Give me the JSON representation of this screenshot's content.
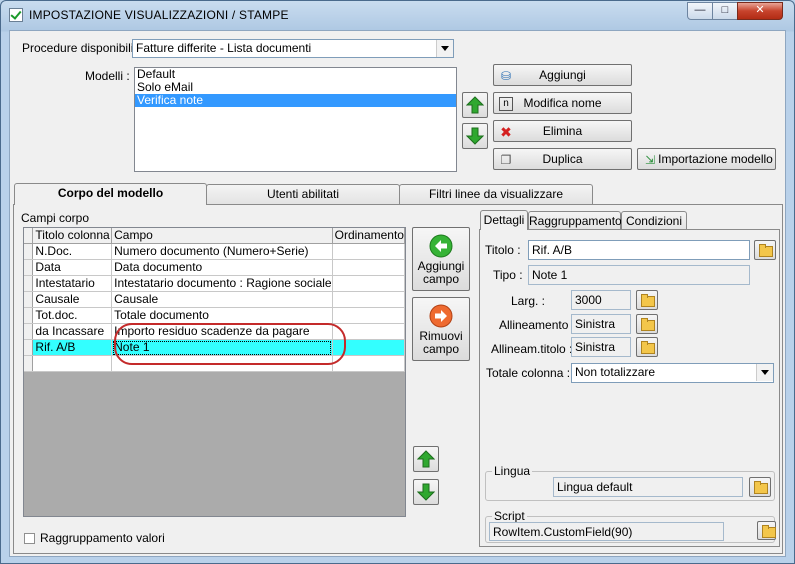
{
  "window": {
    "title": "IMPOSTAZIONE VISUALIZZAZIONI / STAMPE",
    "controls": {
      "minimize": "—",
      "maximize": "□",
      "close": "✕"
    }
  },
  "top": {
    "procedure_label": "Procedure disponibili :",
    "procedure_value": "Fatture differite - Lista documenti",
    "models_label": "Modelli :",
    "models": [
      "Default",
      "Solo eMail",
      "Verifica note"
    ],
    "selected_model_index": 2,
    "buttons": {
      "add": "Aggiungi",
      "rename": "Modifica nome",
      "delete": "Elimina",
      "duplicate": "Duplica",
      "import": "Importazione modello"
    }
  },
  "tabs": [
    "Corpo del modello",
    "Utenti abilitati",
    "Filtri linee da visualizzare"
  ],
  "body": {
    "group_label": "Campi corpo",
    "columns": [
      "Titolo colonna",
      "Campo",
      "Ordinamento"
    ],
    "rows": [
      {
        "title": "N.Doc.",
        "field": "Numero documento (Numero+Serie)",
        "order": ""
      },
      {
        "title": "Data",
        "field": "Data documento",
        "order": ""
      },
      {
        "title": "Intestatario",
        "field": "Intestatario documento : Ragione sociale",
        "order": ""
      },
      {
        "title": "Causale",
        "field": "Causale",
        "order": ""
      },
      {
        "title": "Tot.doc.",
        "field": "Totale documento",
        "order": ""
      },
      {
        "title": "da Incassare",
        "field": "Importo residuo scadenze da pagare",
        "order": ""
      },
      {
        "title": "Rif. A/B",
        "field": "Note 1",
        "order": ""
      },
      {
        "title": "",
        "field": "",
        "order": ""
      }
    ],
    "selected_row_index": 6,
    "add_field": [
      "Aggiungi",
      "campo"
    ],
    "remove_field": [
      "Rimuovi",
      "campo"
    ],
    "group_values_label": "Raggruppamento valori"
  },
  "details": {
    "tabs": [
      "Dettagli",
      "Raggruppamento",
      "Condizioni"
    ],
    "title_label": "Titolo :",
    "title_value": "Rif. A/B",
    "type_label": "Tipo :",
    "type_value": "Note 1",
    "width_label": "Larg. :",
    "width_value": "3000",
    "align_label": "Allineamento :",
    "align_value": "Sinistra",
    "title_align_label": "Allineam.titolo :",
    "title_align_value": "Sinistra",
    "total_label": "Totale colonna :",
    "total_value": "Non totalizzare",
    "language_label": "Lingua",
    "language_value": "Lingua default",
    "script_label": "Script",
    "script_value": "RowItem.CustomField(90)"
  },
  "colors": {
    "selected_row": "#33ffff",
    "selected_list_item": "#3399ff",
    "annotation": "#c42a2a",
    "arrow_green": "#2fa82f",
    "arrow_orange": "#e8642a"
  }
}
